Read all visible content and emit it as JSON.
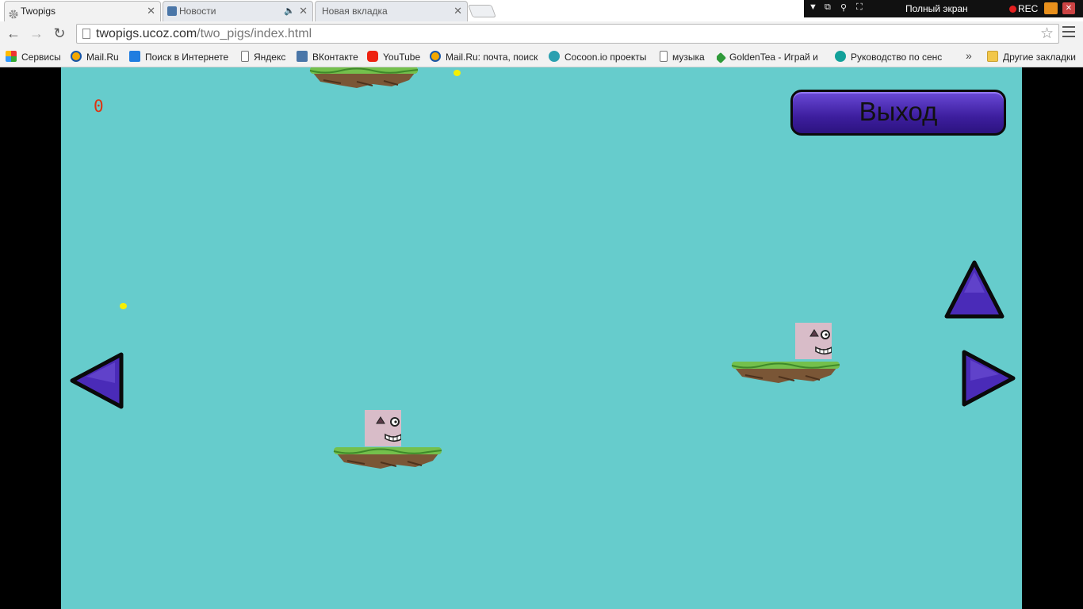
{
  "browser": {
    "tabs": [
      {
        "title": "Twopigs",
        "active": true
      },
      {
        "title": "Новости",
        "active": false,
        "audio": true
      },
      {
        "title": "Новая вкладка",
        "active": false
      }
    ],
    "url_host": "twopigs.ucoz.com",
    "url_path": "/two_pigs/index.html",
    "bookmarks": [
      {
        "label": "Сервисы",
        "icon": "apps-icon"
      },
      {
        "label": "Mail.Ru",
        "icon": "mailru-icon"
      },
      {
        "label": "Поиск в Интернете",
        "icon": "search-icon"
      },
      {
        "label": "Яндекс",
        "icon": "page-icon"
      },
      {
        "label": "ВКонтакте",
        "icon": "vk-icon"
      },
      {
        "label": "YouTube",
        "icon": "youtube-icon"
      },
      {
        "label": "Mail.Ru: почта, поиск",
        "icon": "mailru-icon"
      },
      {
        "label": "Cocoon.io проекты",
        "icon": "cocoon-icon"
      },
      {
        "label": "музыка",
        "icon": "page-icon"
      },
      {
        "label": "GoldenTea - Играй и",
        "icon": "goldentea-icon"
      },
      {
        "label": "Руководство по сенс",
        "icon": "guide-icon"
      }
    ],
    "other_bookmarks": "Другие закладки",
    "overflow": "»"
  },
  "recorder": {
    "fullscreen_label": "Полный экран",
    "rec_label": "REC"
  },
  "game": {
    "score": "0",
    "exit_label": "Выход",
    "colors": {
      "background": "#66cccc",
      "button": "#4a2bb8",
      "score": "#dd3311",
      "coin": "#f6f000",
      "pig": "#d8bcc8"
    }
  }
}
